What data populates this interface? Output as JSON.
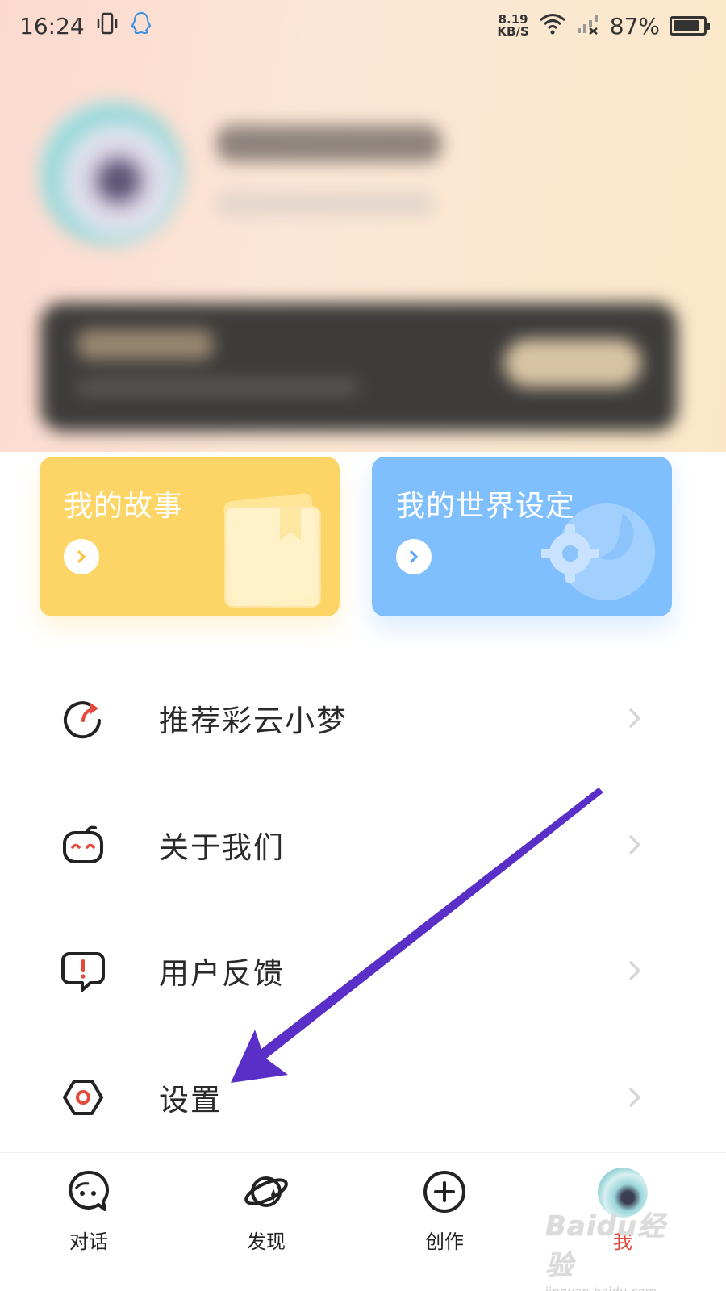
{
  "status_bar": {
    "time": "16:24",
    "net_speed_value": "8.19",
    "net_speed_unit": "KB/S",
    "battery_percent_label": "87%",
    "battery_level": 0.87
  },
  "feature_cards": [
    {
      "title": "我的故事",
      "color": "#fdd566"
    },
    {
      "title": "我的世界设定",
      "color": "#80bffd"
    }
  ],
  "menu": {
    "items": [
      {
        "label": "推荐彩云小梦",
        "icon": "share-refresh-icon"
      },
      {
        "label": "关于我们",
        "icon": "robot-face-icon"
      },
      {
        "label": "用户反馈",
        "icon": "feedback-bubble-icon"
      },
      {
        "label": "设置",
        "icon": "settings-hexagon-icon"
      }
    ]
  },
  "bottom_nav": {
    "items": [
      {
        "label": "对话",
        "icon": "chat-face-icon",
        "active": false
      },
      {
        "label": "发现",
        "icon": "discover-planet-icon",
        "active": false
      },
      {
        "label": "创作",
        "icon": "plus-circle-icon",
        "active": false
      },
      {
        "label": "我",
        "icon": "user-avatar",
        "active": true
      }
    ],
    "active_color": "#e24a3b"
  },
  "annotation": {
    "color": "#5a2fc8"
  },
  "watermark": {
    "logo_text": "Baidu经验",
    "url_text": "jingyan.baidu.com"
  }
}
